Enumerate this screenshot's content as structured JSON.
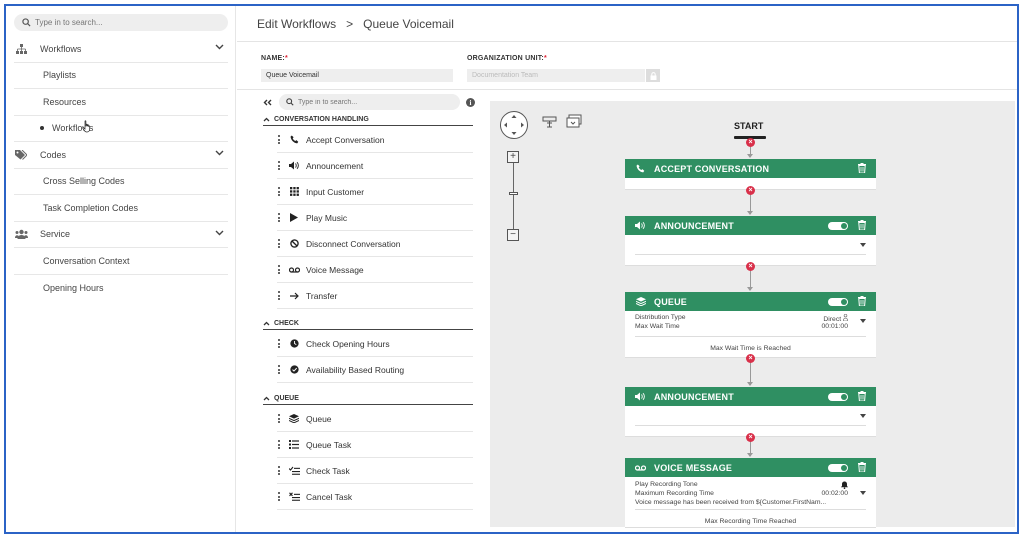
{
  "sidebar": {
    "search_placeholder": "Type in to search...",
    "items": [
      {
        "label": "Workflows",
        "type": "section"
      },
      {
        "label": "Playlists",
        "type": "sub"
      },
      {
        "label": "Resources",
        "type": "sub"
      },
      {
        "label": "Workflows",
        "type": "active"
      },
      {
        "label": "Codes",
        "type": "section"
      },
      {
        "label": "Cross Selling Codes",
        "type": "sub"
      },
      {
        "label": "Task Completion Codes",
        "type": "sub"
      },
      {
        "label": "Service",
        "type": "section"
      },
      {
        "label": "Conversation Context",
        "type": "sub"
      },
      {
        "label": "Opening Hours",
        "type": "sub"
      }
    ]
  },
  "breadcrumb": {
    "parent": "Edit Workflows",
    "separator": ">",
    "current": "Queue Voicemail"
  },
  "fields": {
    "name_label": "NAME:",
    "name_value": "Queue Voicemail",
    "org_label": "ORGANIZATION UNIT:",
    "org_value": "Documentation Team",
    "required_mark": "*"
  },
  "palette": {
    "search_placeholder": "Type in to search...",
    "info": "i",
    "sections": [
      {
        "title": "CONVERSATION HANDLING",
        "items": [
          "Accept Conversation",
          "Announcement",
          "Input Customer",
          "Play Music",
          "Disconnect Conversation",
          "Voice Message",
          "Transfer"
        ]
      },
      {
        "title": "CHECK",
        "items": [
          "Check Opening Hours",
          "Availability Based Routing"
        ]
      },
      {
        "title": "QUEUE",
        "items": [
          "Queue",
          "Queue Task",
          "Check Task",
          "Cancel Task"
        ]
      }
    ]
  },
  "canvas": {
    "start_label": "START",
    "nodes": {
      "accept": {
        "title": "ACCEPT CONVERSATION"
      },
      "announce1": {
        "title": "ANNOUNCEMENT"
      },
      "queue": {
        "title": "QUEUE",
        "rows": [
          {
            "label": "Distribution Type",
            "value": "Direct"
          },
          {
            "label": "Max Wait Time",
            "value": "00:01:00"
          }
        ],
        "footer": "Max Wait Time is Reached"
      },
      "announce2": {
        "title": "ANNOUNCEMENT"
      },
      "voice": {
        "title": "VOICE MESSAGE",
        "rows": [
          {
            "label": "Play Recording Tone",
            "value": ""
          },
          {
            "label": "Maximum Recording Time",
            "value": "00:02:00"
          },
          {
            "label": "Voice message has been received from ${Customer.FirstNam...",
            "value": ""
          }
        ],
        "footer": "Max Recording Time Reached"
      }
    },
    "delete_symbol": "×"
  },
  "colors": {
    "node_header": "#2f8f62",
    "delete": "#d9304a",
    "frame": "#2b63c6",
    "canvas_bg": "#ececec"
  }
}
